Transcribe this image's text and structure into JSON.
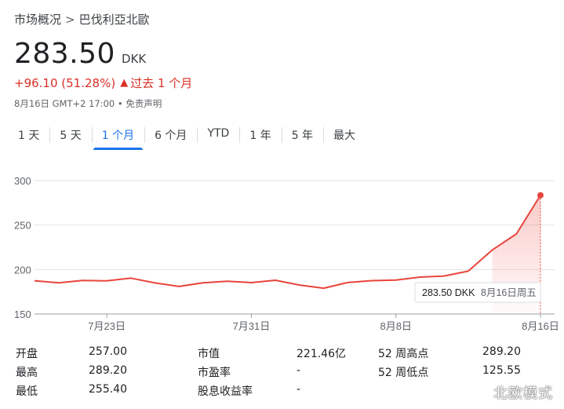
{
  "breadcrumb": {
    "root": "市场概况",
    "separator": ">",
    "current": "巴伐利亞北歐"
  },
  "quote": {
    "price": "283.50",
    "currency": "DKK",
    "change": "+96.10 (51.28%)",
    "period": "过去 1 个月",
    "timestamp": "8月16日 GMT+2 17:00",
    "disclaimer": "• 免责声明"
  },
  "tabs": [
    "1 天",
    "5 天",
    "1 个月",
    "6 个月",
    "YTD",
    "1 年",
    "5 年",
    "最大"
  ],
  "active_tab": "1 个月",
  "colors": {
    "accent": "#1a73e8",
    "negative_change": "#d93025",
    "line": "#e8453c"
  },
  "chart_data": {
    "type": "area",
    "y_ticks": [
      150,
      200,
      250,
      300
    ],
    "ylim": [
      150,
      300
    ],
    "x_ticks": [
      "7月23日",
      "7月31日",
      "8月8日",
      "8月16日"
    ],
    "x": [
      "7月18日",
      "7月19日",
      "7月22日",
      "7月23日",
      "7月24日",
      "7月25日",
      "7月26日",
      "7月29日",
      "7月30日",
      "7月31日",
      "8月1日",
      "8月2日",
      "8月5日",
      "8月6日",
      "8月7日",
      "8月8日",
      "8月9日",
      "8月12日",
      "8月13日",
      "8月14日",
      "8月15日",
      "8月16日"
    ],
    "values": [
      187.4,
      185.0,
      187.8,
      187.2,
      190.3,
      184.9,
      181.0,
      185.1,
      186.9,
      185.3,
      187.9,
      182.6,
      179.0,
      185.4,
      187.5,
      188.1,
      191.5,
      192.7,
      198.2,
      222.0,
      240.0,
      283.5
    ],
    "tooltip": {
      "value": "283.50 DKK",
      "date": "8月16日周五"
    }
  },
  "stats": [
    {
      "label": "开盘",
      "value": "257.00"
    },
    {
      "label": "最高",
      "value": "289.20"
    },
    {
      "label": "最低",
      "value": "255.40"
    },
    {
      "label": "市值",
      "value": "221.46亿"
    },
    {
      "label": "市盈率",
      "value": "-"
    },
    {
      "label": "股息收益率",
      "value": "-"
    },
    {
      "label": "52 周高点",
      "value": "289.20"
    },
    {
      "label": "52 周低点",
      "value": "125.55"
    }
  ],
  "watermark": "北欧模式"
}
